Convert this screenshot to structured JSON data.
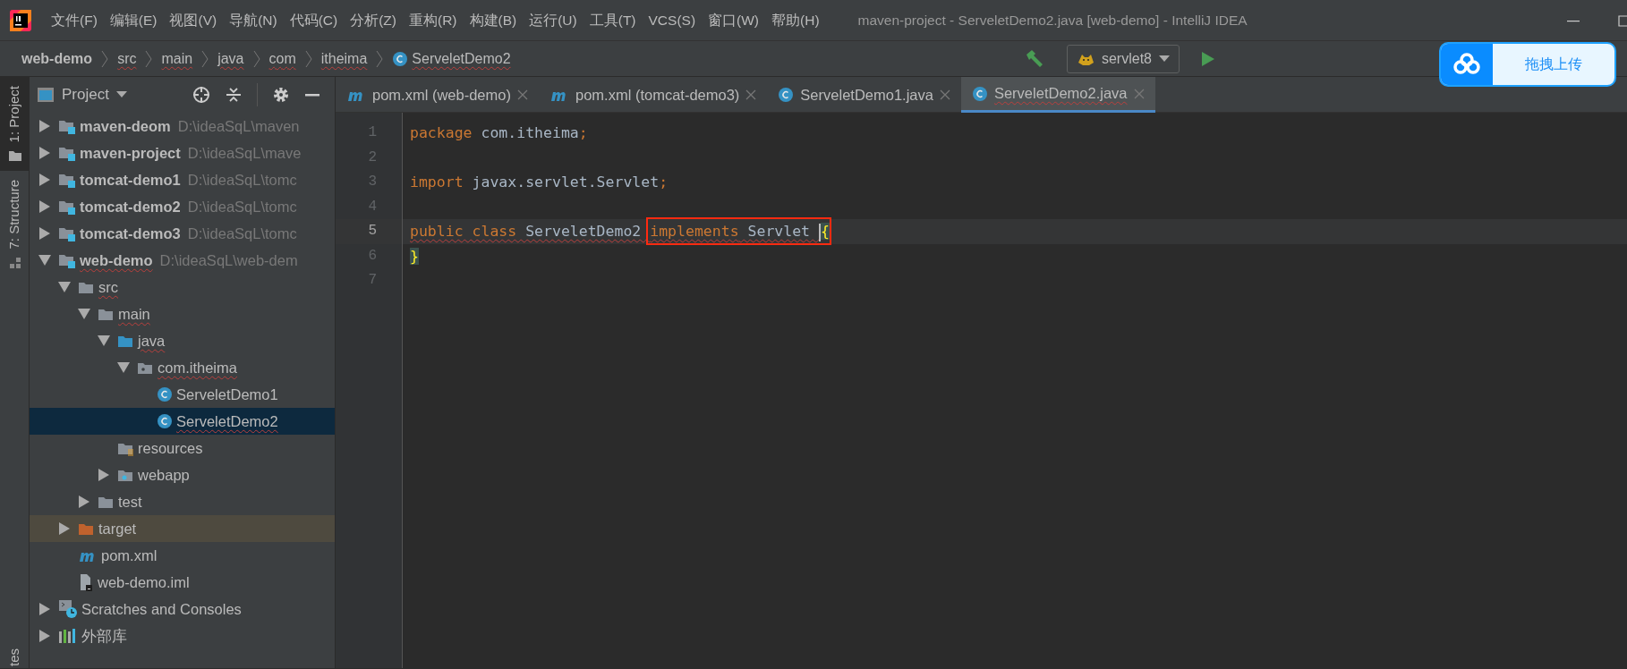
{
  "window": {
    "title": "maven-project - ServeletDemo2.java [web-demo] - IntelliJ IDEA"
  },
  "menu": [
    "文件(F)",
    "编辑(E)",
    "视图(V)",
    "导航(N)",
    "代码(C)",
    "分析(Z)",
    "重构(R)",
    "构建(B)",
    "运行(U)",
    "工具(T)",
    "VCS(S)",
    "窗口(W)",
    "帮助(H)"
  ],
  "breadcrumb": [
    {
      "label": "web-demo",
      "kind": "module",
      "error": false
    },
    {
      "label": "src",
      "kind": "folder",
      "error": true
    },
    {
      "label": "main",
      "kind": "folder",
      "error": true
    },
    {
      "label": "java",
      "kind": "folder",
      "error": true
    },
    {
      "label": "com",
      "kind": "folder",
      "error": true
    },
    {
      "label": "itheima",
      "kind": "folder",
      "error": true
    },
    {
      "label": "ServeletDemo2",
      "kind": "class",
      "error": true
    }
  ],
  "run_config": {
    "label": "servlet8"
  },
  "upload_widget": {
    "label": "拖拽上传"
  },
  "side_stripe": [
    {
      "label": "1: Project",
      "selected": true,
      "kind": "project"
    },
    {
      "label": "7: Structure",
      "selected": false,
      "kind": "structure"
    },
    {
      "label": "tes",
      "selected": false,
      "kind": "none"
    }
  ],
  "project_panel": {
    "title": "Project",
    "tree": [
      {
        "label": "maven-deom",
        "path": "D:\\ideaSqL\\maven",
        "kind": "module",
        "expanded": false,
        "selected": false,
        "error": false
      },
      {
        "label": "maven-project",
        "path": "D:\\ideaSqL\\mave",
        "kind": "module",
        "expanded": false,
        "selected": false,
        "error": false
      },
      {
        "label": "tomcat-demo1",
        "path": "D:\\ideaSqL\\tomc",
        "kind": "module",
        "expanded": false,
        "selected": false,
        "error": false
      },
      {
        "label": "tomcat-demo2",
        "path": "D:\\ideaSqL\\tomc",
        "kind": "module",
        "expanded": false,
        "selected": false,
        "error": false
      },
      {
        "label": "tomcat-demo3",
        "path": "D:\\ideaSqL\\tomc",
        "kind": "module",
        "expanded": false,
        "selected": false,
        "error": false
      },
      {
        "label": "web-demo",
        "path": "D:\\ideaSqL\\web-dem",
        "kind": "module",
        "expanded": true,
        "selected": false,
        "error": true,
        "children": [
          {
            "label": "src",
            "kind": "folder",
            "expanded": true,
            "selected": false,
            "error": true,
            "children": [
              {
                "label": "main",
                "kind": "folder",
                "expanded": true,
                "selected": false,
                "error": true,
                "children": [
                  {
                    "label": "java",
                    "kind": "source",
                    "expanded": true,
                    "selected": false,
                    "error": true,
                    "children": [
                      {
                        "label": "com.itheima",
                        "kind": "package",
                        "expanded": true,
                        "selected": false,
                        "error": true,
                        "children": [
                          {
                            "label": "ServeletDemo1",
                            "kind": "class",
                            "selected": false,
                            "error": false
                          },
                          {
                            "label": "ServeletDemo2",
                            "kind": "class",
                            "selected": true,
                            "error": true
                          }
                        ]
                      }
                    ]
                  },
                  {
                    "label": "resources",
                    "kind": "resources",
                    "selected": false,
                    "error": false
                  },
                  {
                    "label": "webapp",
                    "kind": "webapp",
                    "expanded": false,
                    "selected": false,
                    "error": false
                  }
                ]
              },
              {
                "label": "test",
                "kind": "folder",
                "expanded": false,
                "selected": false,
                "error": false
              }
            ]
          },
          {
            "label": "target",
            "kind": "excluded",
            "expanded": false,
            "selected": false,
            "error": false
          },
          {
            "label": "pom.xml",
            "kind": "maven",
            "selected": false,
            "error": false
          },
          {
            "label": "web-demo.iml",
            "kind": "iml",
            "selected": false,
            "error": false
          }
        ]
      },
      {
        "label": "Scratches and Consoles",
        "kind": "scratches",
        "expanded": false,
        "selected": false,
        "error": false
      },
      {
        "label": "外部库",
        "kind": "libraries",
        "expanded": false,
        "selected": false,
        "error": false
      }
    ]
  },
  "tabs": [
    {
      "label": "pom.xml (web-demo)",
      "kind": "maven",
      "selected": false,
      "error": false
    },
    {
      "label": "pom.xml (tomcat-demo3)",
      "kind": "maven",
      "selected": false,
      "error": false
    },
    {
      "label": "ServeletDemo1.java",
      "kind": "class",
      "selected": false,
      "error": false
    },
    {
      "label": "ServeletDemo2.java",
      "kind": "class",
      "selected": true,
      "error": true
    }
  ],
  "editor": {
    "lines": [
      {
        "number": "1",
        "current": false,
        "tokens": [
          {
            "text": "package",
            "kind": "keyword"
          },
          {
            "text": " com.itheima",
            "kind": "plain"
          },
          {
            "text": ";",
            "kind": "keyword"
          }
        ]
      },
      {
        "number": "2",
        "current": false
      },
      {
        "number": "3",
        "current": false,
        "tokens": [
          {
            "text": "import",
            "kind": "keyword"
          },
          {
            "text": " javax.servlet.Servlet",
            "kind": "plain"
          },
          {
            "text": ";",
            "kind": "keyword"
          }
        ]
      },
      {
        "number": "4",
        "current": false
      },
      {
        "number": "5",
        "current": true,
        "tokens": [
          {
            "text": "public class",
            "kind": "keyword",
            "error": true
          },
          {
            "text": " ServeletDemo2 ",
            "kind": "plain",
            "error": true
          },
          {
            "text": "implements",
            "kind": "keyword",
            "error": true,
            "boxed": true
          },
          {
            "text": " Servlet ",
            "kind": "plain",
            "error": true,
            "boxed": true
          },
          {
            "text": "{",
            "kind": "brace",
            "matched": true,
            "boxed": true
          }
        ]
      },
      {
        "number": "6",
        "current": false,
        "tokens": [
          {
            "text": "}",
            "kind": "brace",
            "matched": true
          }
        ]
      },
      {
        "number": "7",
        "current": false
      }
    ]
  }
}
